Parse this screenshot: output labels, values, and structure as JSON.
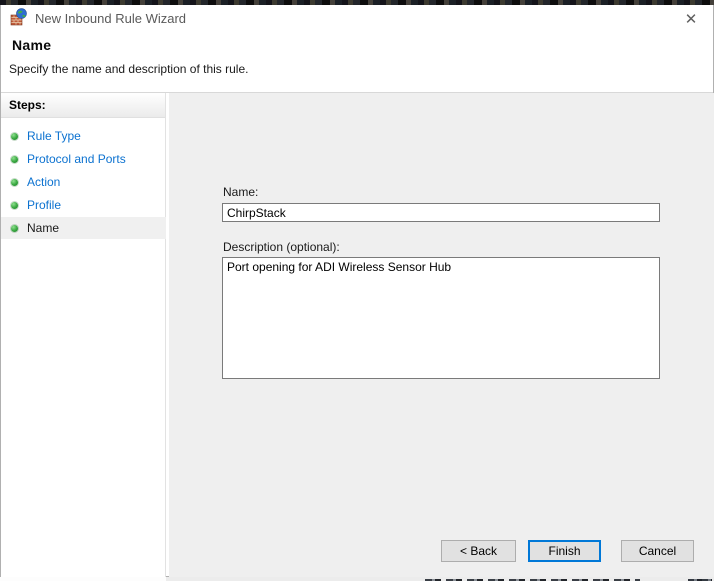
{
  "window": {
    "title": "New Inbound Rule Wizard"
  },
  "header": {
    "title": "Name",
    "subtitle": "Specify the name and description of this rule."
  },
  "sidebar": {
    "heading": "Steps:",
    "items": [
      {
        "label": "Rule Type",
        "state": "completed"
      },
      {
        "label": "Protocol and Ports",
        "state": "completed"
      },
      {
        "label": "Action",
        "state": "completed"
      },
      {
        "label": "Profile",
        "state": "completed"
      },
      {
        "label": "Name",
        "state": "current"
      }
    ]
  },
  "form": {
    "name_label": "Name:",
    "name_value": "ChirpStack",
    "description_label": "Description (optional):",
    "description_value": "Port opening for ADI Wireless Sensor Hub"
  },
  "buttons": {
    "back": "< Back",
    "finish": "Finish",
    "cancel": "Cancel"
  },
  "icons": {
    "app": "firewall-icon",
    "close_glyph": "✕",
    "step_bullet": "green-dot"
  },
  "colors": {
    "step_link_blue": "#0c72d0",
    "bullet_green": "#2e9e3a",
    "finish_focus_border": "#0078d7",
    "button_bg": "#e1e1e1",
    "button_border": "#adadad",
    "panel_gray": "#efefef",
    "input_border": "#7a7a7a",
    "title_text_gray": "#5a5a5a"
  }
}
